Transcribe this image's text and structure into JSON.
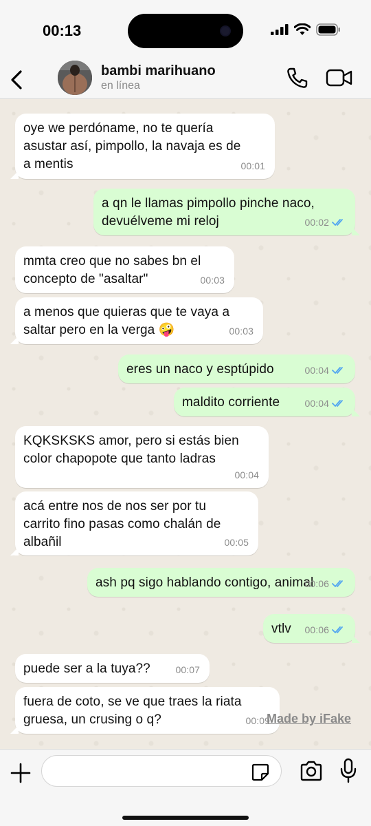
{
  "status_bar": {
    "time": "00:13"
  },
  "header": {
    "back_icon": "chevron-left-icon",
    "contact_name": "bambi marihuano",
    "contact_status": "en línea",
    "call_icon": "phone-icon",
    "video_icon": "video-camera-icon"
  },
  "messages": [
    {
      "dir": "in",
      "text": "oye we perdóname, no te quería\nasustar así, pimpollo, la navaja es de\na mentis",
      "time": "00:01"
    },
    {
      "dir": "out",
      "text": "a qn le llamas pimpollo pinche naco,\ndevuélveme mi reloj",
      "time": "00:02",
      "read": true
    },
    {
      "dir": "in",
      "text": "mmta creo que no sabes bn el\nconcepto de \"asaltar\"",
      "time": "00:03"
    },
    {
      "dir": "in",
      "text": "a menos que quieras que te vaya a\nsaltar pero en la verga 🤪",
      "time": "00:03"
    },
    {
      "dir": "out",
      "text": "eres un naco y esptúpido",
      "time": "00:04",
      "read": true
    },
    {
      "dir": "out",
      "text": "maldito corriente",
      "time": "00:04",
      "read": true
    },
    {
      "dir": "in",
      "text": "KQKSKSKS amor, pero si estás bien\ncolor chapopote que tanto ladras",
      "time": "00:04"
    },
    {
      "dir": "in",
      "text": "acá entre nos de nos ser por tu\ncarrito fino pasas como chalán de\nalbañil",
      "time": "00:05"
    },
    {
      "dir": "out",
      "text": "ash pq sigo hablando contigo, animal",
      "time": "00:06",
      "read": true
    },
    {
      "dir": "out",
      "text": "vtlv",
      "time": "00:06",
      "read": true
    },
    {
      "dir": "in",
      "text": "puede ser a la tuya??",
      "time": "00:07"
    },
    {
      "dir": "in",
      "text": "fuera de coto, se ve que traes la riata\ngruesa, un crusing o q?",
      "time": "00:09"
    }
  ],
  "watermark": "Made by iFake",
  "input_bar": {
    "placeholder": "",
    "plus_icon": "plus-icon",
    "sticker_icon": "sticker-icon",
    "camera_icon": "camera-icon",
    "mic_icon": "microphone-icon"
  },
  "colors": {
    "chat_background": "#efeae2",
    "incoming_bubble": "#ffffff",
    "outgoing_bubble": "#d9fdd3",
    "read_tick": "#53a6f0"
  }
}
